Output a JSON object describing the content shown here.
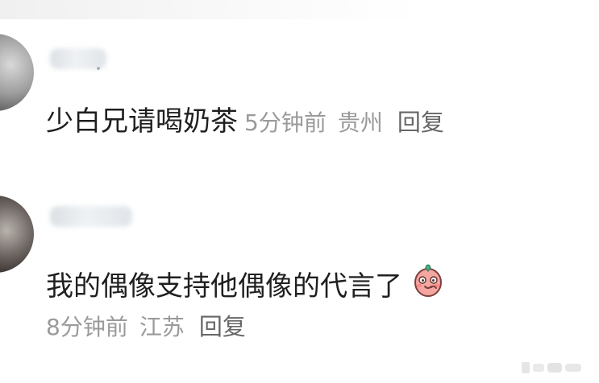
{
  "comments": [
    {
      "text": "少白兄请喝奶茶",
      "time": "5分钟前",
      "location": "贵州",
      "reply_label": "回复"
    },
    {
      "text": "我的偶像支持他偶像的代言了",
      "time": "8分钟前",
      "location": "江苏",
      "reply_label": "回复",
      "emoji": "blushing-face-emoji"
    }
  ],
  "icons": {
    "user_avatar": "avatar-photo",
    "watermark": "weibo-watermark"
  },
  "colors": {
    "primary_text": "#1f1f1f",
    "meta_text": "#9a9a9a",
    "reply_text": "#666666",
    "background": "#ffffff",
    "emoji_fill": "#f4a6a0"
  }
}
